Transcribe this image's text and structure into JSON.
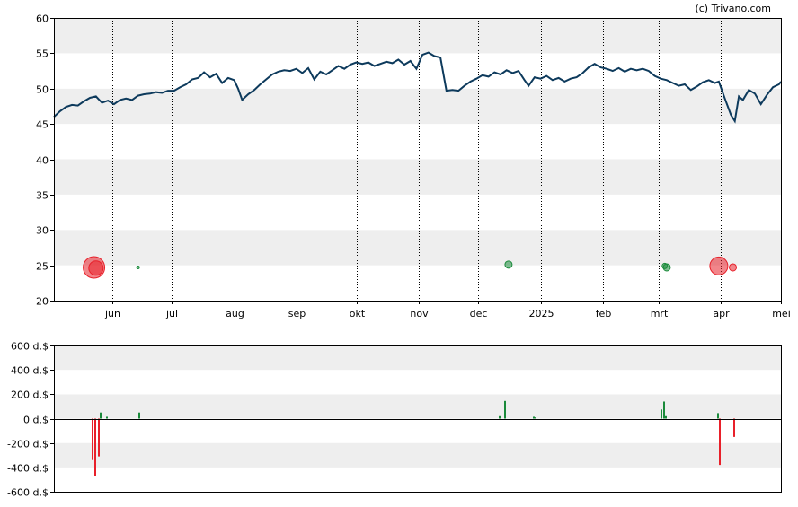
{
  "copyright": "(c) Trivano.com",
  "chart_data": [
    {
      "type": "line",
      "title": "",
      "xlabel": "",
      "ylabel": "",
      "ylim": [
        20,
        60
      ],
      "y_ticks": [
        20,
        25,
        30,
        35,
        40,
        45,
        50,
        55,
        60
      ],
      "x_ticks": [
        {
          "label": "jun",
          "date": "2024-06-01"
        },
        {
          "label": "jul",
          "date": "2024-07-01"
        },
        {
          "label": "aug",
          "date": "2024-08-01"
        },
        {
          "label": "sep",
          "date": "2024-09-01"
        },
        {
          "label": "okt",
          "date": "2024-10-01"
        },
        {
          "label": "nov",
          "date": "2024-11-01"
        },
        {
          "label": "dec",
          "date": "2024-12-01"
        },
        {
          "label": "2025",
          "date": "2025-01-01"
        },
        {
          "label": "feb",
          "date": "2025-02-01"
        },
        {
          "label": "mrt",
          "date": "2025-03-01"
        },
        {
          "label": "apr",
          "date": "2025-04-01"
        },
        {
          "label": "mei",
          "date": "2025-05-01"
        }
      ],
      "xlim": [
        "2024-05-03",
        "2025-05-01"
      ],
      "grid": "alternating horizontal bands, dotted vertical month lines",
      "series": [
        {
          "color": "#0d3a5c",
          "points": [
            [
              "2024-05-03",
              46.0
            ],
            [
              "2024-05-06",
              46.8
            ],
            [
              "2024-05-09",
              47.4
            ],
            [
              "2024-05-12",
              47.7
            ],
            [
              "2024-05-15",
              47.6
            ],
            [
              "2024-05-18",
              48.2
            ],
            [
              "2024-05-21",
              48.7
            ],
            [
              "2024-05-24",
              48.9
            ],
            [
              "2024-05-27",
              48.0
            ],
            [
              "2024-05-30",
              48.3
            ],
            [
              "2024-06-02",
              47.8
            ],
            [
              "2024-06-05",
              48.4
            ],
            [
              "2024-06-08",
              48.6
            ],
            [
              "2024-06-11",
              48.4
            ],
            [
              "2024-06-14",
              49.0
            ],
            [
              "2024-06-17",
              49.2
            ],
            [
              "2024-06-20",
              49.3
            ],
            [
              "2024-06-23",
              49.5
            ],
            [
              "2024-06-26",
              49.4
            ],
            [
              "2024-06-29",
              49.7
            ],
            [
              "2024-07-02",
              49.7
            ],
            [
              "2024-07-05",
              50.2
            ],
            [
              "2024-07-08",
              50.6
            ],
            [
              "2024-07-11",
              51.3
            ],
            [
              "2024-07-14",
              51.5
            ],
            [
              "2024-07-17",
              52.3
            ],
            [
              "2024-07-20",
              51.6
            ],
            [
              "2024-07-23",
              52.1
            ],
            [
              "2024-07-26",
              50.8
            ],
            [
              "2024-07-29",
              51.5
            ],
            [
              "2024-08-01",
              51.2
            ],
            [
              "2024-08-03",
              50.0
            ],
            [
              "2024-08-05",
              48.4
            ],
            [
              "2024-08-08",
              49.2
            ],
            [
              "2024-08-11",
              49.8
            ],
            [
              "2024-08-14",
              50.6
            ],
            [
              "2024-08-17",
              51.3
            ],
            [
              "2024-08-20",
              52.0
            ],
            [
              "2024-08-23",
              52.4
            ],
            [
              "2024-08-26",
              52.6
            ],
            [
              "2024-08-29",
              52.5
            ],
            [
              "2024-09-01",
              52.8
            ],
            [
              "2024-09-04",
              52.2
            ],
            [
              "2024-09-07",
              52.9
            ],
            [
              "2024-09-10",
              51.3
            ],
            [
              "2024-09-13",
              52.4
            ],
            [
              "2024-09-16",
              52.0
            ],
            [
              "2024-09-19",
              52.6
            ],
            [
              "2024-09-22",
              53.2
            ],
            [
              "2024-09-25",
              52.8
            ],
            [
              "2024-09-28",
              53.4
            ],
            [
              "2024-10-01",
              53.7
            ],
            [
              "2024-10-04",
              53.5
            ],
            [
              "2024-10-07",
              53.7
            ],
            [
              "2024-10-10",
              53.2
            ],
            [
              "2024-10-13",
              53.5
            ],
            [
              "2024-10-16",
              53.8
            ],
            [
              "2024-10-19",
              53.6
            ],
            [
              "2024-10-22",
              54.1
            ],
            [
              "2024-10-25",
              53.4
            ],
            [
              "2024-10-28",
              53.9
            ],
            [
              "2024-10-31",
              52.8
            ],
            [
              "2024-11-03",
              54.8
            ],
            [
              "2024-11-06",
              55.1
            ],
            [
              "2024-11-09",
              54.6
            ],
            [
              "2024-11-12",
              54.4
            ],
            [
              "2024-11-15",
              49.7
            ],
            [
              "2024-11-18",
              49.8
            ],
            [
              "2024-11-21",
              49.7
            ],
            [
              "2024-11-24",
              50.4
            ],
            [
              "2024-11-27",
              51.0
            ],
            [
              "2024-11-30",
              51.4
            ],
            [
              "2024-12-03",
              51.9
            ],
            [
              "2024-12-06",
              51.7
            ],
            [
              "2024-12-09",
              52.3
            ],
            [
              "2024-12-12",
              52.0
            ],
            [
              "2024-12-15",
              52.6
            ],
            [
              "2024-12-18",
              52.2
            ],
            [
              "2024-12-21",
              52.5
            ],
            [
              "2024-12-24",
              51.2
            ],
            [
              "2024-12-26",
              50.4
            ],
            [
              "2024-12-29",
              51.6
            ],
            [
              "2025-01-01",
              51.4
            ],
            [
              "2025-01-04",
              51.8
            ],
            [
              "2025-01-07",
              51.2
            ],
            [
              "2025-01-10",
              51.5
            ],
            [
              "2025-01-13",
              51.0
            ],
            [
              "2025-01-16",
              51.4
            ],
            [
              "2025-01-19",
              51.6
            ],
            [
              "2025-01-22",
              52.2
            ],
            [
              "2025-01-25",
              53.0
            ],
            [
              "2025-01-28",
              53.5
            ],
            [
              "2025-01-31",
              53.0
            ],
            [
              "2025-02-03",
              52.8
            ],
            [
              "2025-02-06",
              52.5
            ],
            [
              "2025-02-09",
              52.9
            ],
            [
              "2025-02-12",
              52.4
            ],
            [
              "2025-02-15",
              52.8
            ],
            [
              "2025-02-18",
              52.6
            ],
            [
              "2025-02-21",
              52.8
            ],
            [
              "2025-02-24",
              52.5
            ],
            [
              "2025-02-27",
              51.8
            ],
            [
              "2025-03-02",
              51.4
            ],
            [
              "2025-03-05",
              51.2
            ],
            [
              "2025-03-08",
              50.8
            ],
            [
              "2025-03-11",
              50.4
            ],
            [
              "2025-03-14",
              50.6
            ],
            [
              "2025-03-17",
              49.8
            ],
            [
              "2025-03-20",
              50.3
            ],
            [
              "2025-03-23",
              50.9
            ],
            [
              "2025-03-26",
              51.2
            ],
            [
              "2025-03-29",
              50.8
            ],
            [
              "2025-03-31",
              51.0
            ],
            [
              "2025-04-03",
              48.6
            ],
            [
              "2025-04-06",
              46.3
            ],
            [
              "2025-04-08",
              45.4
            ],
            [
              "2025-04-10",
              48.9
            ],
            [
              "2025-04-12",
              48.4
            ],
            [
              "2025-04-15",
              49.8
            ],
            [
              "2025-04-18",
              49.3
            ],
            [
              "2025-04-21",
              47.8
            ],
            [
              "2025-04-24",
              49.1
            ],
            [
              "2025-04-27",
              50.2
            ],
            [
              "2025-04-30",
              50.6
            ],
            [
              "2025-05-01",
              51.0
            ]
          ]
        }
      ],
      "markers": [
        {
          "date": "2024-05-23",
          "y": 24.7,
          "size": 12,
          "color": "#e8202a"
        },
        {
          "date": "2024-05-24",
          "y": 24.6,
          "size": 8,
          "color": "#e8202a"
        },
        {
          "date": "2024-06-14",
          "y": 24.7,
          "size": 1.5,
          "color": "#1a8a3a"
        },
        {
          "date": "2024-12-16",
          "y": 25.1,
          "size": 4,
          "color": "#1a8a3a"
        },
        {
          "date": "2025-03-04",
          "y": 24.9,
          "size": 3,
          "color": "#1a8a3a"
        },
        {
          "date": "2025-03-05",
          "y": 24.7,
          "size": 4,
          "color": "#1a8a3a"
        },
        {
          "date": "2025-03-31",
          "y": 24.9,
          "size": 10,
          "color": "#e8202a"
        },
        {
          "date": "2025-04-07",
          "y": 24.7,
          "size": 4,
          "color": "#e8202a"
        }
      ]
    },
    {
      "type": "bar",
      "title": "",
      "ylim": [
        -600,
        600
      ],
      "y_ticks": [
        {
          "value": 600,
          "label": "600 d.$"
        },
        {
          "value": 400,
          "label": "400 d.$"
        },
        {
          "value": 200,
          "label": "200 d.$"
        },
        {
          "value": 0,
          "label": "0 d.$"
        },
        {
          "value": -200,
          "label": "-200 d.$"
        },
        {
          "value": -400,
          "label": "-400 d.$"
        },
        {
          "value": -600,
          "label": "-600 d.$"
        }
      ],
      "bars": [
        {
          "date": "2024-05-22",
          "value": -340,
          "color": "#e8202a"
        },
        {
          "date": "2024-05-23",
          "value": -470,
          "color": "#e8202a"
        },
        {
          "date": "2024-05-25",
          "value": -310,
          "color": "#e8202a"
        },
        {
          "date": "2024-05-26",
          "value": 50,
          "color": "#1a8a3a"
        },
        {
          "date": "2024-05-29",
          "value": 15,
          "color": "#1a8a3a"
        },
        {
          "date": "2024-06-14",
          "value": 50,
          "color": "#1a8a3a"
        },
        {
          "date": "2024-12-11",
          "value": 20,
          "color": "#1a8a3a"
        },
        {
          "date": "2024-12-14",
          "value": 145,
          "color": "#1a8a3a"
        },
        {
          "date": "2024-12-28",
          "value": 15,
          "color": "#1a8a3a"
        },
        {
          "date": "2024-12-29",
          "value": 10,
          "color": "#1a8a3a"
        },
        {
          "date": "2025-03-02",
          "value": 75,
          "color": "#1a8a3a"
        },
        {
          "date": "2025-03-03",
          "value": 140,
          "color": "#1a8a3a"
        },
        {
          "date": "2025-03-04",
          "value": 20,
          "color": "#1a8a3a"
        },
        {
          "date": "2025-03-30",
          "value": 45,
          "color": "#1a8a3a"
        },
        {
          "date": "2025-03-31",
          "value": -380,
          "color": "#e8202a"
        },
        {
          "date": "2025-04-07",
          "value": -150,
          "color": "#e8202a"
        }
      ]
    }
  ]
}
